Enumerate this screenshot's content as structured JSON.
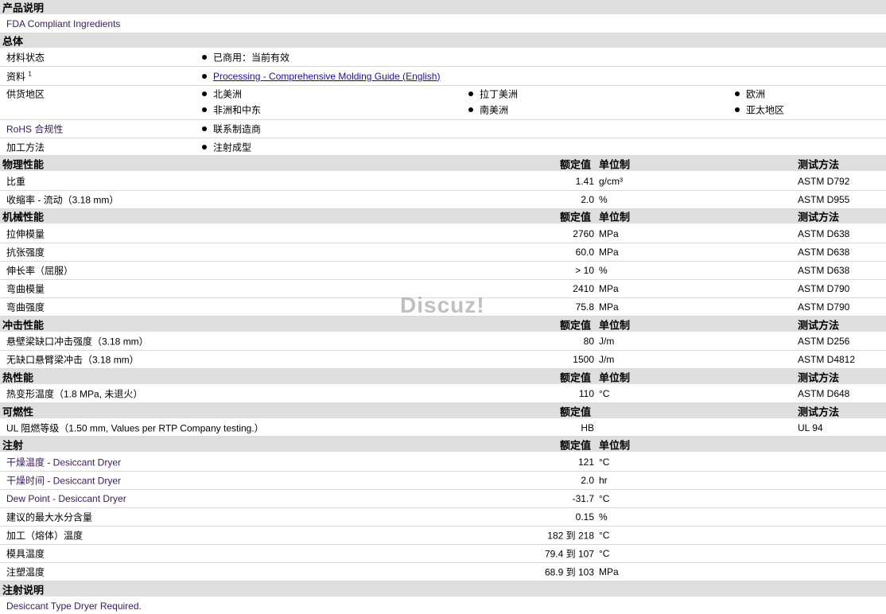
{
  "product": {
    "heading": "产品说明",
    "text": "FDA Compliant Ingredients"
  },
  "general": {
    "heading": "总体",
    "material_status": {
      "label": "材料状态",
      "value": "已商用：当前有效"
    },
    "literature": {
      "label": "资料",
      "sup": "1",
      "value": "Processing - Comprehensive Molding Guide (English)"
    },
    "availability": {
      "label": "供货地区",
      "regions": [
        "北美洲",
        "拉丁美洲",
        "欧洲",
        "非洲和中东",
        "南美洲",
        "亚太地区"
      ]
    },
    "rohs": {
      "label": "RoHS 合规性",
      "value": "联系制造商"
    },
    "processing_method": {
      "label": "加工方法",
      "value": "注射成型"
    }
  },
  "col": {
    "nominal": "额定值",
    "unit": "单位制",
    "test": "测试方法"
  },
  "physical": {
    "heading": "物理性能",
    "rows": [
      {
        "label": "比重",
        "value": "1.41",
        "unit": "g/cm³",
        "test": "ASTM D792"
      },
      {
        "label": "收缩率  - 流动（3.18 mm）",
        "value": "2.0",
        "unit": "%",
        "test": "ASTM D955"
      }
    ]
  },
  "mechanical": {
    "heading": "机械性能",
    "rows": [
      {
        "label": "拉伸模量",
        "value": "2760",
        "unit": "MPa",
        "test": "ASTM D638"
      },
      {
        "label": "抗张强度",
        "value": "60.0",
        "unit": "MPa",
        "test": "ASTM D638"
      },
      {
        "label": "伸长率（屈服）",
        "value": "> 10",
        "unit": "%",
        "test": "ASTM D638"
      },
      {
        "label": "弯曲模量",
        "value": "2410",
        "unit": "MPa",
        "test": "ASTM D790"
      },
      {
        "label": "弯曲强度",
        "value": "75.8",
        "unit": "MPa",
        "test": "ASTM D790"
      }
    ]
  },
  "impact": {
    "heading": "冲击性能",
    "rows": [
      {
        "label": "悬壁梁缺口冲击强度（3.18 mm）",
        "value": "80",
        "unit": "J/m",
        "test": "ASTM D256"
      },
      {
        "label": "无缺口悬臂梁冲击（3.18 mm）",
        "value": "1500",
        "unit": "J/m",
        "test": "ASTM D4812"
      }
    ]
  },
  "thermal": {
    "heading": "热性能",
    "rows": [
      {
        "label": "热变形温度（1.8 MPa, 未退火）",
        "value": "110",
        "unit": "°C",
        "test": "ASTM D648"
      }
    ]
  },
  "flammability": {
    "heading": "可燃性",
    "rows": [
      {
        "label": "UL 阻燃等级（1.50 mm, Values per RTP Company testing.）",
        "value": "HB",
        "unit": "",
        "test": "UL 94"
      }
    ]
  },
  "injection": {
    "heading": "注射",
    "rows": [
      {
        "label": "干燥温度  - Desiccant Dryer",
        "value": "121",
        "unit": "°C"
      },
      {
        "label": "干燥时间  - Desiccant Dryer",
        "value": "2.0",
        "unit": "hr"
      },
      {
        "label": "Dew Point - Desiccant Dryer",
        "value": "-31.7",
        "unit": "°C"
      },
      {
        "label": "建议的最大水分含量",
        "value": "0.15",
        "unit": "%"
      },
      {
        "label": "加工（熔体）温度",
        "value": "182 到  218",
        "unit": "°C"
      },
      {
        "label": "模具温度",
        "value": "79.4 到  107",
        "unit": "°C"
      },
      {
        "label": "注塑温度",
        "value": "68.9 到  103",
        "unit": "MPa"
      }
    ]
  },
  "injection_notes": {
    "heading": "注射说明",
    "text": "Desiccant Type Dryer Required."
  },
  "watermark": "Discuz!"
}
